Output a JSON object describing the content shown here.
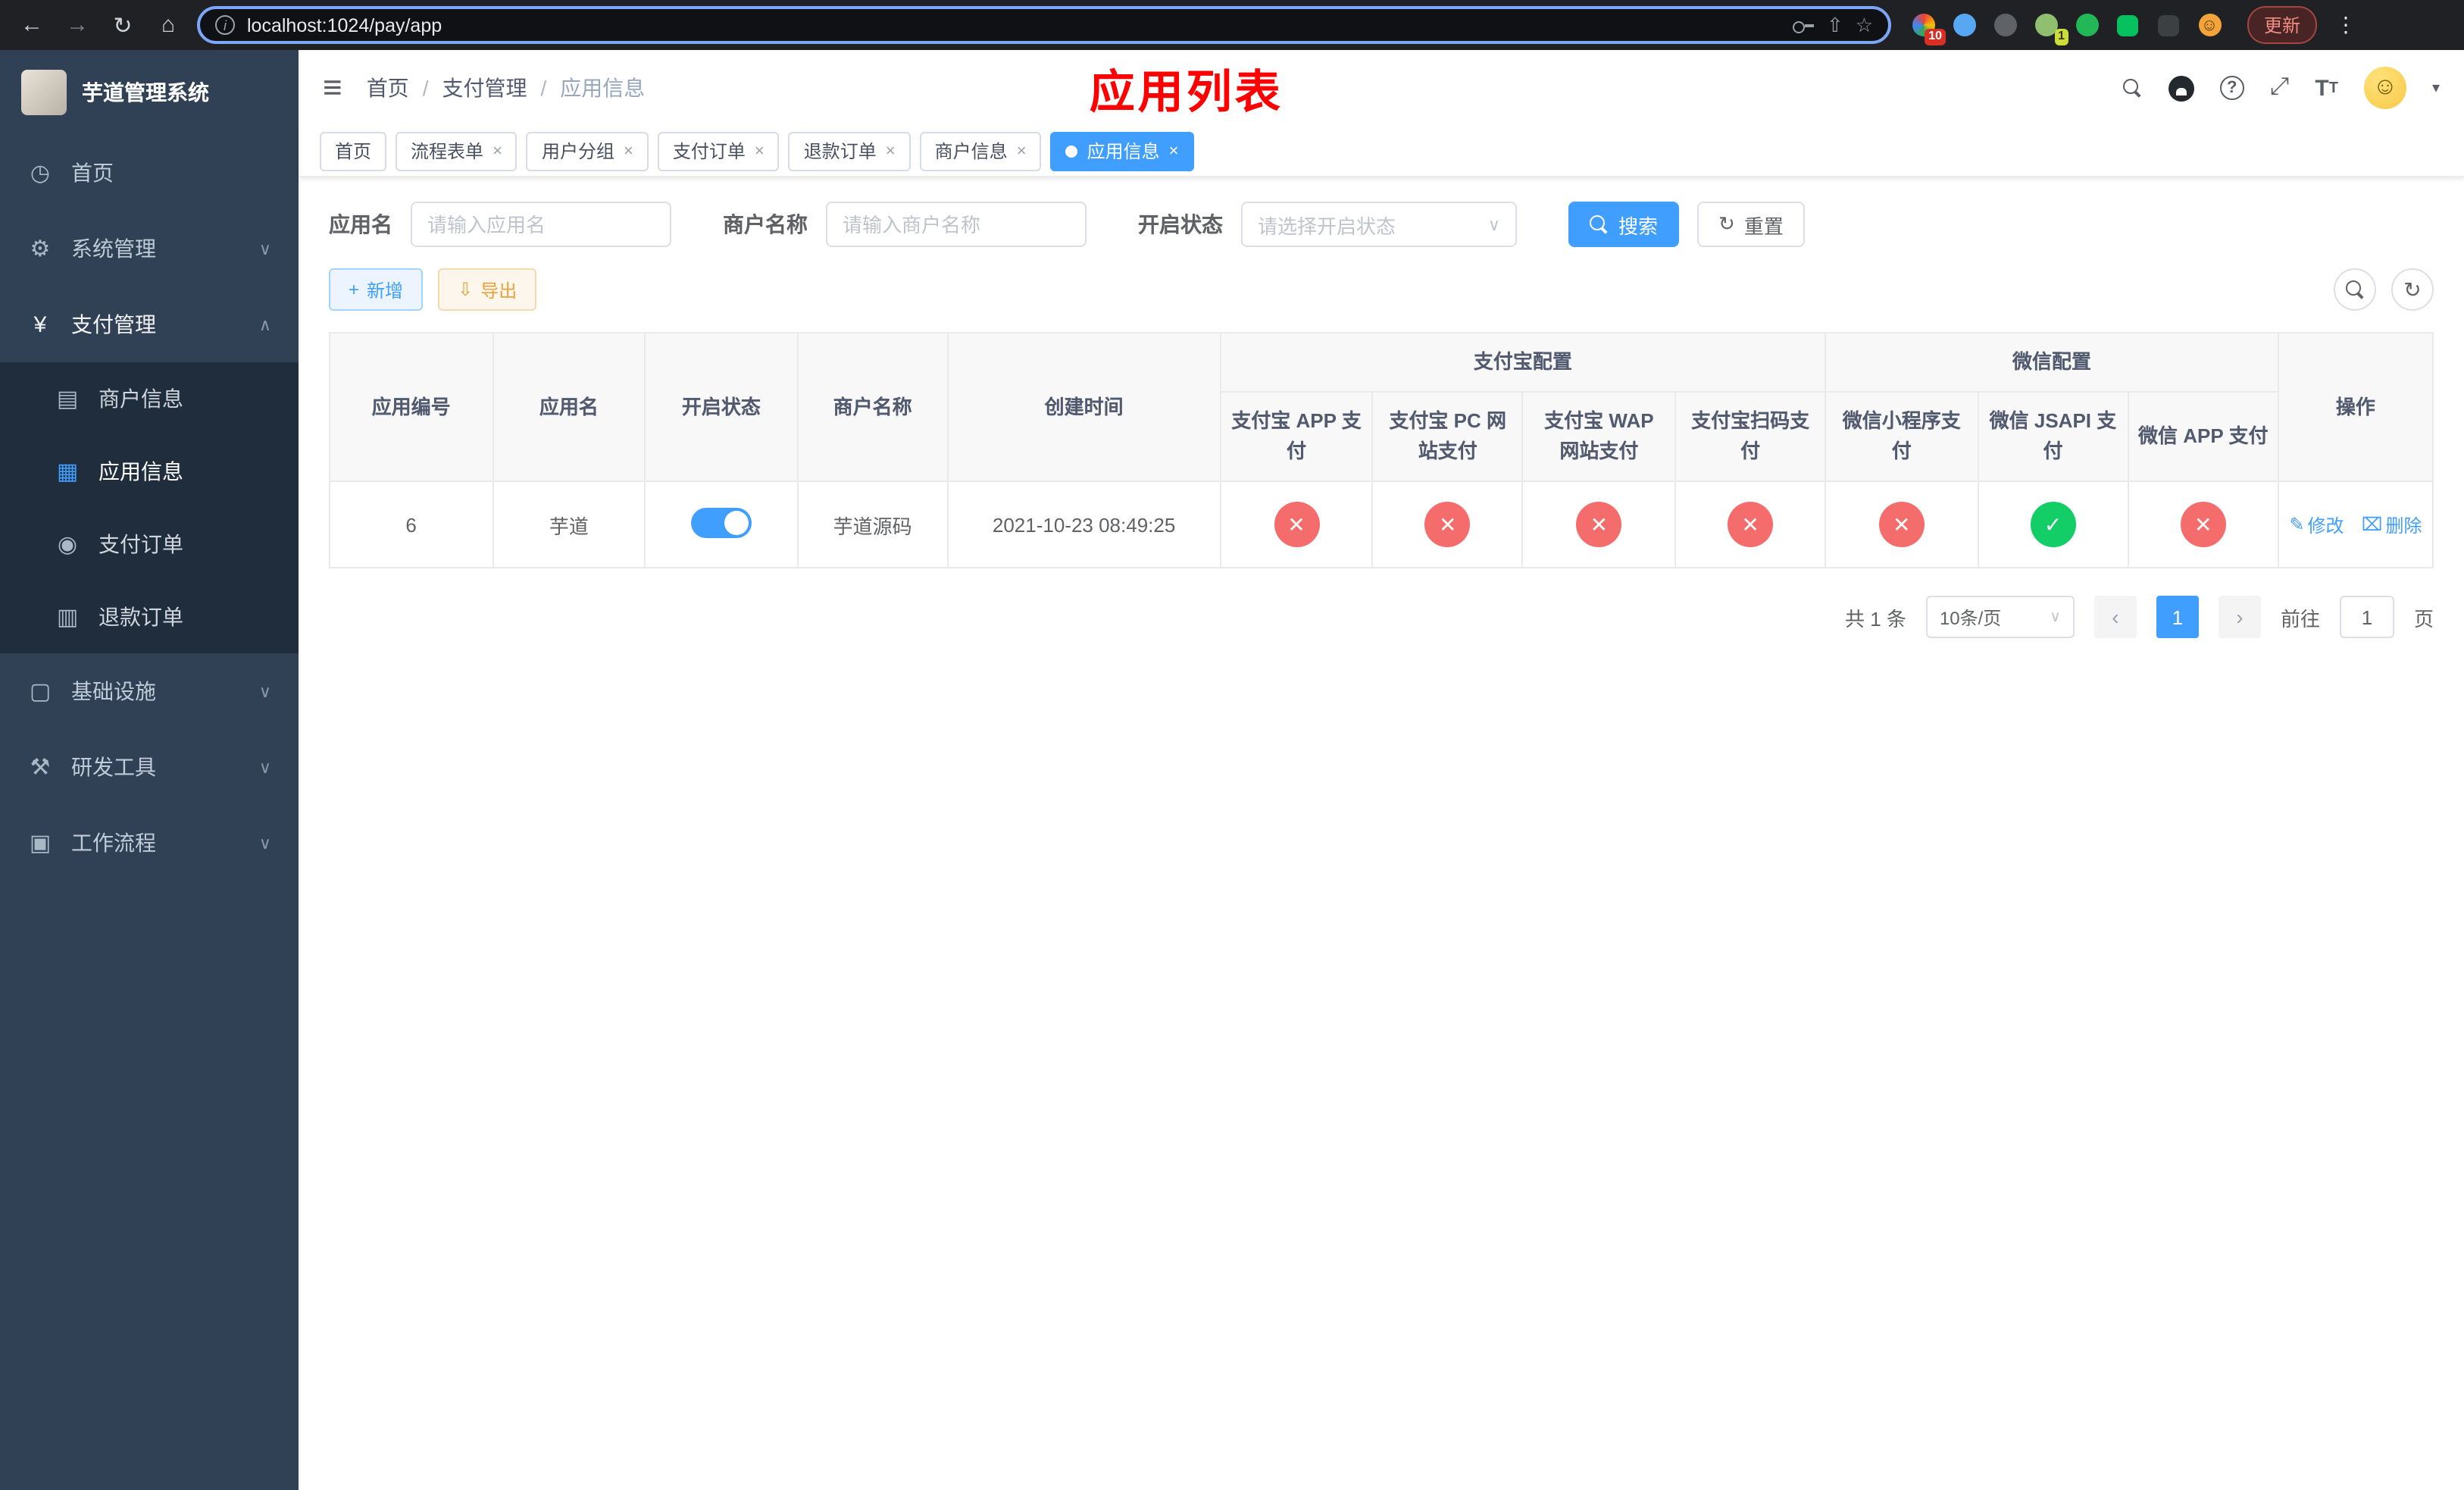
{
  "browser": {
    "url": "localhost:1024/pay/app",
    "update_label": "更新",
    "ext_badge_colorful": "10",
    "ext_badge_avatar": "1"
  },
  "icons": {
    "back": "←",
    "forward": "→",
    "reload": "↻",
    "home": "⌂",
    "share": "⇧",
    "star": "☆",
    "menu_dots": "⋮",
    "info": "i",
    "hamburger": "≡",
    "caret_down": "▾",
    "chevron_down": "∨",
    "chevron_up": "∧",
    "dashboard": "◷",
    "gear": "⚙",
    "yen": "¥",
    "merchant": "▤",
    "app": "▦",
    "order": "◉",
    "refund": "▥",
    "infra": "▢",
    "tools": "⚒",
    "flow": "▣",
    "fullscreen": "⤢",
    "font_size_big": "T",
    "font_size_small": "T",
    "refresh": "↻",
    "plus": "+",
    "download": "⇩",
    "edit": "✎",
    "delete": "⌧",
    "prev": "‹",
    "next": "›",
    "smiley": "☺",
    "rabbit": "•ᴥ•"
  },
  "sidebar": {
    "title": "芋道管理系统",
    "items": {
      "home": "首页",
      "system": "系统管理",
      "pay": "支付管理",
      "merchant": "商户信息",
      "app": "应用信息",
      "order": "支付订单",
      "refund": "退款订单",
      "infra": "基础设施",
      "dev": "研发工具",
      "flow": "工作流程"
    }
  },
  "navbar": {
    "breadcrumb": {
      "home": "首页",
      "pay": "支付管理",
      "app": "应用信息"
    },
    "overlay_title": "应用列表"
  },
  "tabs": [
    {
      "label": "首页"
    },
    {
      "label": "流程表单"
    },
    {
      "label": "用户分组"
    },
    {
      "label": "支付订单"
    },
    {
      "label": "退款订单"
    },
    {
      "label": "商户信息"
    },
    {
      "label": "应用信息"
    }
  ],
  "filters": {
    "app_name_label": "应用名",
    "app_name_placeholder": "请输入应用名",
    "merchant_label": "商户名称",
    "merchant_placeholder": "请输入商户名称",
    "status_label": "开启状态",
    "status_placeholder": "请选择开启状态",
    "search_label": "搜索",
    "reset_label": "重置"
  },
  "toolbar": {
    "add_label": "新增",
    "export_label": "导出"
  },
  "table": {
    "groups": {
      "alipay": "支付宝配置",
      "wechat": "微信配置"
    },
    "cols": {
      "id": "应用编号",
      "name": "应用名",
      "status": "开启状态",
      "merchant": "商户名称",
      "created": "创建时间",
      "alipay_app": "支付宝 APP 支付",
      "alipay_pc": "支付宝 PC 网站支付",
      "alipay_wap": "支付宝 WAP 网站支付",
      "alipay_qr": "支付宝扫码支付",
      "wx_lite": "微信小程序支付",
      "wx_jsapi": "微信 JSAPI 支付",
      "wx_app": "微信 APP 支付",
      "actions": "操作"
    },
    "row": {
      "id": "6",
      "name": "芋道",
      "enabled": true,
      "merchant": "芋道源码",
      "created": "2021-10-23 08:49:25",
      "alipay_app": false,
      "alipay_pc": false,
      "alipay_wap": false,
      "alipay_qr": false,
      "wx_lite": false,
      "wx_jsapi": true,
      "wx_app": false,
      "edit_label": "修改",
      "delete_label": "删除"
    }
  },
  "pagination": {
    "total": "共 1 条",
    "size": "10条/页",
    "page": "1",
    "goto_label": "前往",
    "goto_value": "1",
    "unit_label": "页"
  }
}
